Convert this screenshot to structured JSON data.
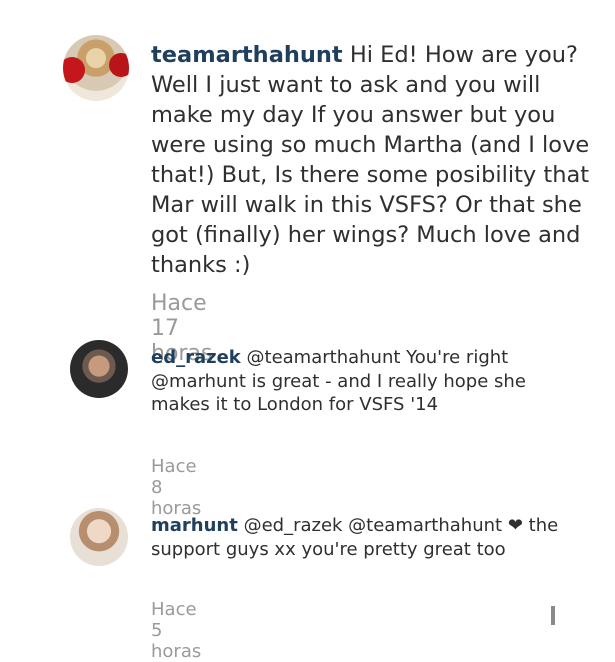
{
  "comments": [
    {
      "username": "teamarthahunt",
      "text": "Hi Ed! How are you? Well I just want to ask and you will make my day If you answer but you were using so much Martha (and I love that!) But, Is there some posibility that Mar will walk in this VSFS? Or that she got (finally) her wings? Much love and thanks :)",
      "time": "Hace 17 horas"
    },
    {
      "username": "ed_razek",
      "text": "@teamarthahunt You're right @marhunt is great - and I really hope she makes it to London for VSFS '14",
      "time": "Hace 8 horas"
    },
    {
      "username": "marhunt",
      "text_before": "@ed_razek @teamarthahunt",
      "heart": "❤",
      "text_after": "the support guys xx you're pretty great too",
      "time": "Hace 5 horas"
    }
  ]
}
